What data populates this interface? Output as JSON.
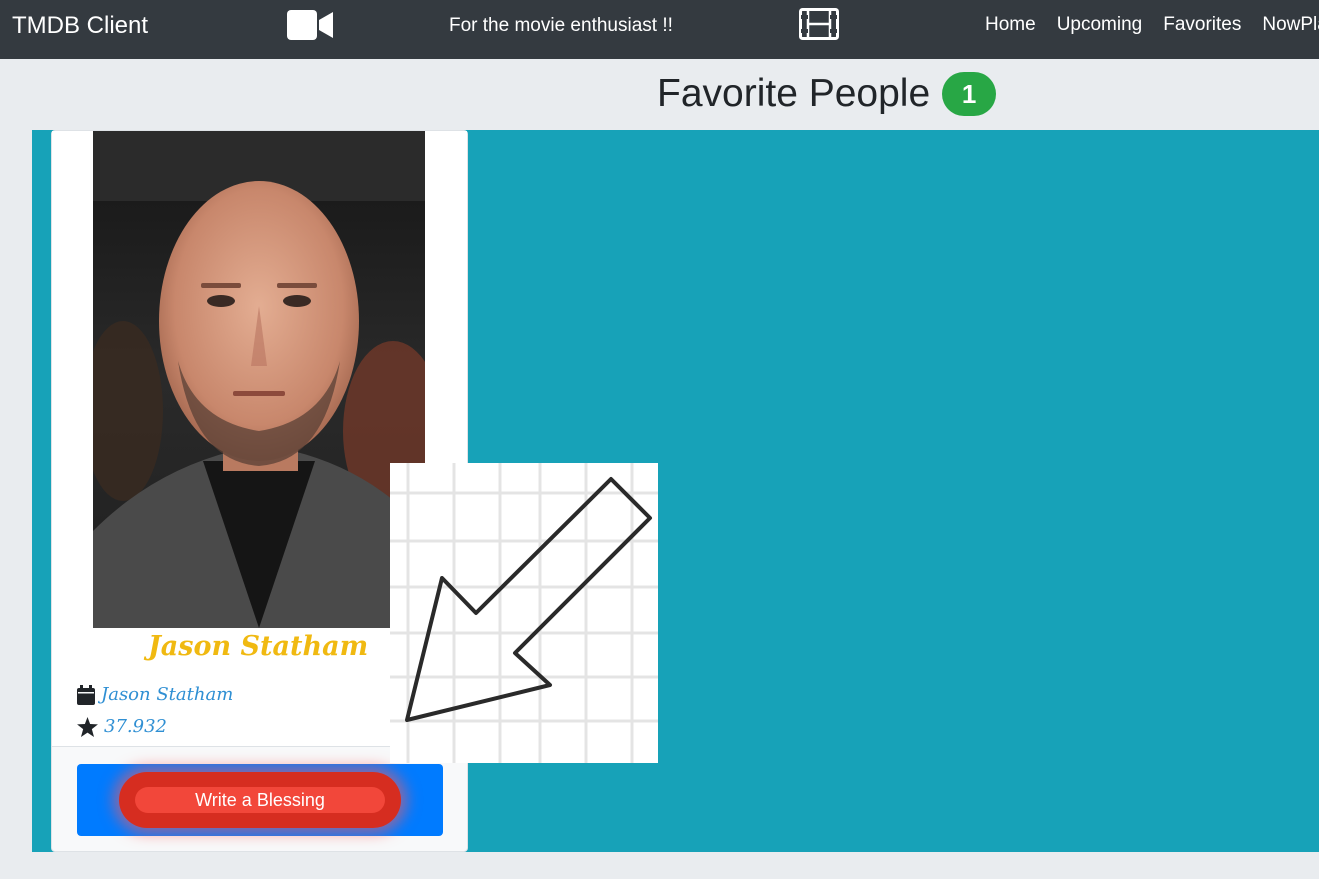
{
  "navbar": {
    "brand": "TMDB Client",
    "tagline": "For the movie enthusiast !!",
    "links": [
      "Home",
      "Upcoming",
      "Favorites",
      "NowPlaying"
    ],
    "icons": [
      "video-camera-icon",
      "film-icon"
    ]
  },
  "page": {
    "title": "Favorite People",
    "count": "1"
  },
  "person": {
    "name": "Jason Statham",
    "subtitle": "Jason Statham",
    "popularity": "37.932",
    "icons": [
      "calendar-icon",
      "star-icon"
    ],
    "photo_alt": "person-photo"
  },
  "actions": {
    "bless_label": "Write a Blessing"
  },
  "colors": {
    "navbar": "#343a40",
    "panel": "#17a2b8",
    "badge": "#28a745",
    "name": "#f0b911",
    "meta": "#2f8fd3",
    "footer": "#007bff",
    "bless": "#d62d20"
  }
}
